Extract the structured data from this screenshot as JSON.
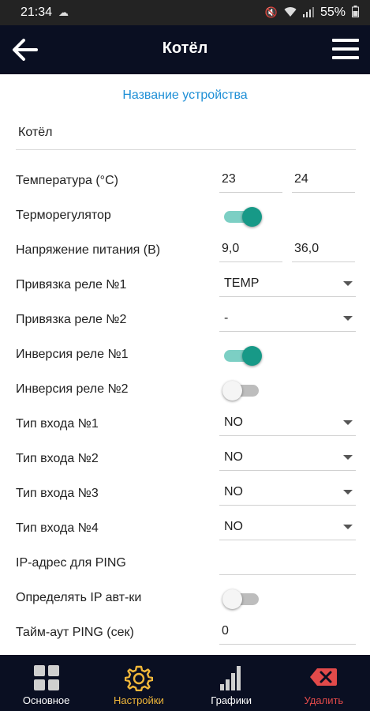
{
  "status_bar": {
    "time": "21:34",
    "battery": "55%"
  },
  "app_bar": {
    "title": "Котёл"
  },
  "section_title": "Название устройства",
  "device_name": "Котёл",
  "rows": {
    "temperature": {
      "label": "Температура (°C)",
      "min": "23",
      "max": "24"
    },
    "thermostat": {
      "label": "Терморегулятор",
      "on": true
    },
    "voltage": {
      "label": "Напряжение питания (В)",
      "min": "9,0",
      "max": "36,0"
    },
    "relay1_bind": {
      "label": "Привязка реле №1",
      "value": "TEMP"
    },
    "relay2_bind": {
      "label": "Привязка реле №2",
      "value": "-"
    },
    "relay1_invert": {
      "label": "Инверсия реле №1",
      "on": true
    },
    "relay2_invert": {
      "label": "Инверсия реле №2",
      "on": false
    },
    "input1": {
      "label": "Тип входа №1",
      "value": "NO"
    },
    "input2": {
      "label": "Тип входа №2",
      "value": "NO"
    },
    "input3": {
      "label": "Тип входа №3",
      "value": "NO"
    },
    "input4": {
      "label": "Тип входа №4",
      "value": "NO"
    },
    "ping_ip": {
      "label": "IP-адрес для PING",
      "value": ""
    },
    "auto_ip": {
      "label": "Определять IP авт-ки",
      "on": false
    },
    "ping_timeout": {
      "label": "Тайм-аут PING (сек)",
      "value": "0"
    }
  },
  "bottom_nav": [
    {
      "label": "Основное",
      "icon": "dashboard-icon"
    },
    {
      "label": "Настройки",
      "icon": "gear-icon",
      "active": true
    },
    {
      "label": "Графики",
      "icon": "bar-chart-icon"
    },
    {
      "label": "Удалить",
      "icon": "delete-icon"
    }
  ],
  "colors": {
    "accent_teal": "#179987",
    "link_blue": "#1e8fd6",
    "nav_active": "#f0b73a",
    "danger": "#e24a4a",
    "bar_bg": "#0a0f22"
  }
}
